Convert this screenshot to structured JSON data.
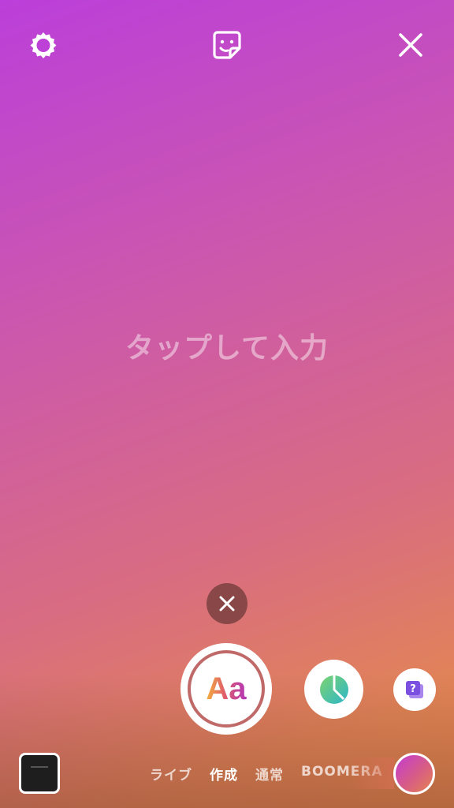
{
  "top_bar": {
    "settings_icon": "gear-icon",
    "sticker_icon": "sticker-icon",
    "close_icon": "close-icon"
  },
  "canvas": {
    "placeholder": "タップして入力"
  },
  "tools": {
    "dismiss_icon": "close-icon",
    "capture_label": "Aa",
    "poll_icon": "pie-chart-icon",
    "question_icon": "question-sticker-icon",
    "question_glyph": "?"
  },
  "modes": [
    {
      "label": "ライブ",
      "active": false
    },
    {
      "label": "作成",
      "active": true
    },
    {
      "label": "通常",
      "active": false
    },
    {
      "label": "BOOMERA",
      "active": false
    }
  ],
  "colors": {
    "gradient_start": "#bb3fda",
    "gradient_end": "#e4884e",
    "capture_ring": "#bf6a68",
    "dismiss_bg": "#8a4747"
  }
}
